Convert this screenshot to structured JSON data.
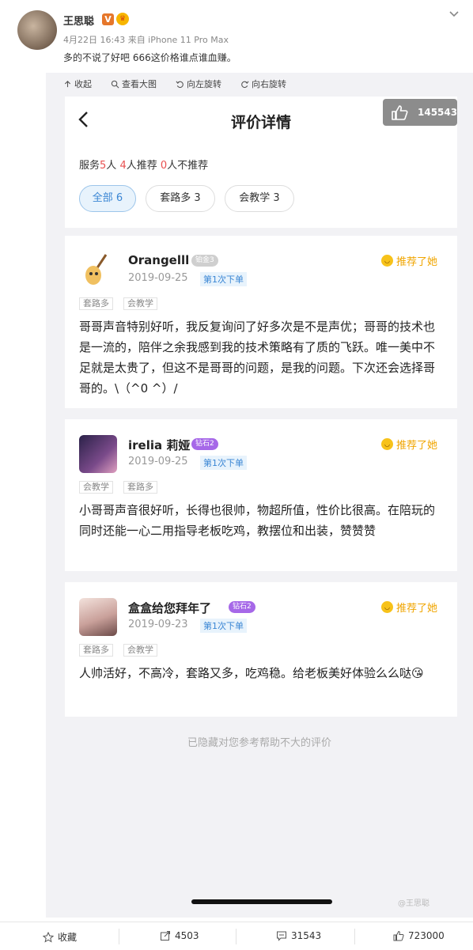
{
  "post": {
    "author": "王思聪",
    "meta": "4月22日 16:43 来自 iPhone 11 Pro Max",
    "text": "多的不说了好吧 666这价格谁点谁血赚。"
  },
  "toolbar": {
    "collapse": "收起",
    "view_large": "查看大图",
    "rotate_left": "向左旋转",
    "rotate_right": "向右旋转"
  },
  "screen": {
    "title": "评价详情",
    "like_count": "145543",
    "summary": {
      "prefix": "服务",
      "service_count": "5",
      "people": "人 ",
      "recommend_count": "4",
      "recommend_label": "人推荐 ",
      "not_count": "0",
      "not_label": "人不推荐"
    },
    "filters": [
      "全部 6",
      "套路多 3",
      "会教学 3"
    ],
    "hidden_note": "已隐藏对您参考帮助不大的评价",
    "watermark": "@王思聪"
  },
  "reviews": [
    {
      "name": "Orangelll",
      "badge": "铂金3",
      "date": "2019-09-25",
      "order": "第1次下单",
      "recommend": "推荐了她",
      "tags": [
        "套路多",
        "会教学"
      ],
      "text": "哥哥声音特别好听，我反复询问了好多次是不是声优；哥哥的技术也是一流的，陪伴之余我感到我的技术策略有了质的飞跃。唯一美中不足就是太贵了，但这不是哥哥的问题，是我的问题。下次还会选择哥哥的。\\（^0 ^）/"
    },
    {
      "name": "irelia 莉娅",
      "badge": "钻石2",
      "date": "2019-09-25",
      "order": "第1次下单",
      "recommend": "推荐了她",
      "tags": [
        "会教学",
        "套路多"
      ],
      "text": "小哥哥声音很好听，长得也很帅，物超所值，性价比很高。在陪玩的同时还能一心二用指导老板吃鸡，教摆位和出装，赞赞赞"
    },
    {
      "name": "盒盒给您拜年了",
      "badge": "钻石2",
      "date": "2019-09-23",
      "order": "第1次下单",
      "recommend": "推荐了她",
      "tags": [
        "套路多",
        "会教学"
      ],
      "text": "人帅活好，不高冷，套路又多，吃鸡稳。给老板美好体验么么哒😘"
    }
  ],
  "bottom": {
    "favorite": "收藏",
    "repost": "4503",
    "comment": "31543",
    "like": "723000"
  }
}
